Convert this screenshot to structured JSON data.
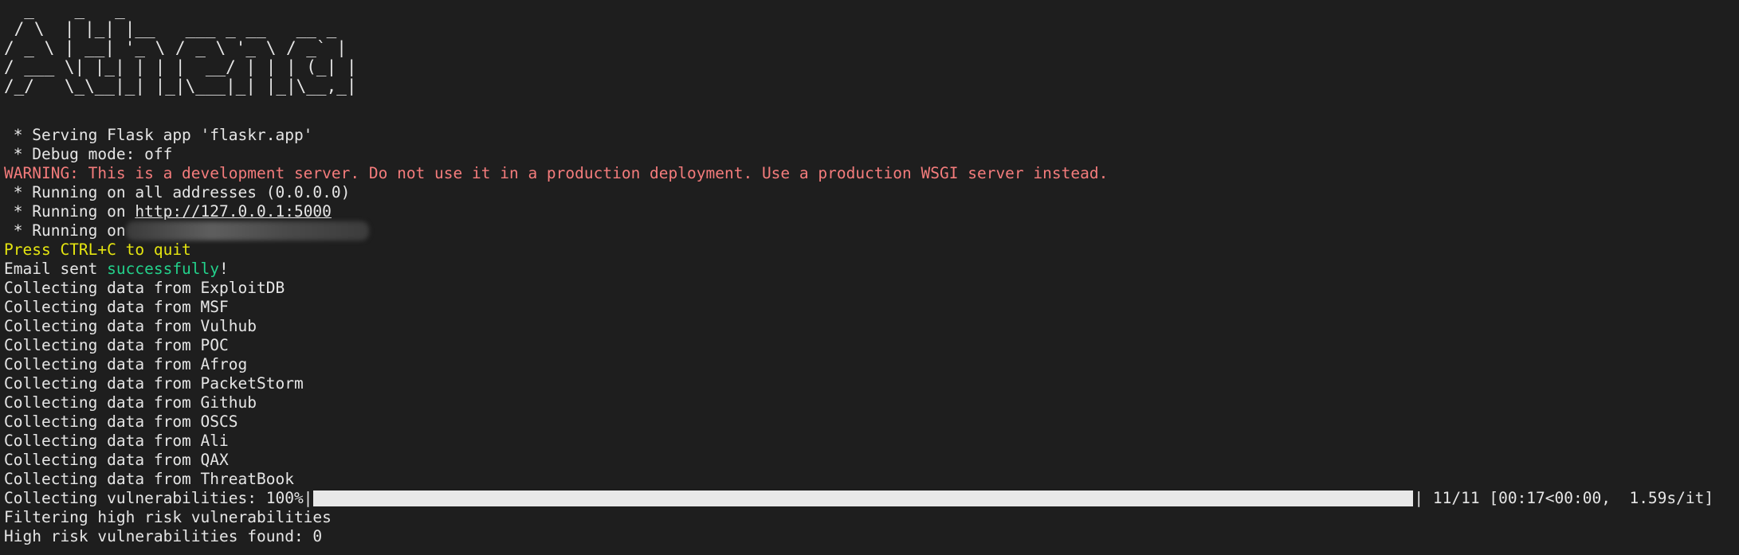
{
  "banner_ascii": [
    "  _    _   _",
    " / \\  | |_| |__   ___ _ __   __ _",
    "/ _ \\ | __| '_ \\ / _ \\ '_ \\ / _` |",
    "/ ___ \\| |_| | | |  __/ | | | (_| |",
    "/_/   \\_\\__|_| |_|\\___|_| |_|\\__,_|"
  ],
  "log": {
    "serving": " * Serving Flask app 'flaskr.app'",
    "debug": " * Debug mode: off",
    "warning": "WARNING: This is a development server. Do not use it in a production deployment. Use a production WSGI server instead.",
    "running_all": " * Running on all addresses (0.0.0.0)",
    "running_prefix": " * Running on ",
    "running_url": "http://127.0.0.1:5000",
    "running_prefix_2": " * Running on",
    "quit_hint": "Press CTRL+C to quit",
    "email_prefix": "Email sent ",
    "email_word": "successfully",
    "email_suffix": "!",
    "collecting": [
      "Collecting data from ExploitDB",
      "Collecting data from MSF",
      "Collecting data from Vulhub",
      "Collecting data from POC",
      "Collecting data from Afrog",
      "Collecting data from PacketStorm",
      "Collecting data from Github",
      "Collecting data from OSCS",
      "Collecting data from Ali",
      "Collecting data from QAX",
      "Collecting data from ThreatBook"
    ],
    "progress": {
      "label": "Collecting vulnerabilities: 100%|",
      "fraction": 1.0,
      "end_bar": "|",
      "stats": " 11/11 [00:17<00:00,  1.59s/it]"
    },
    "filtering": "Filtering high risk vulnerabilities",
    "found": "High risk vulnerabilities found: 0"
  },
  "colors": {
    "background": "#1e1e1e",
    "text": "#e6e6e6",
    "warning": "#f47c7c",
    "yellow": "#e5e510",
    "green": "#23d18b",
    "accent_blue": "#3b8eea"
  }
}
